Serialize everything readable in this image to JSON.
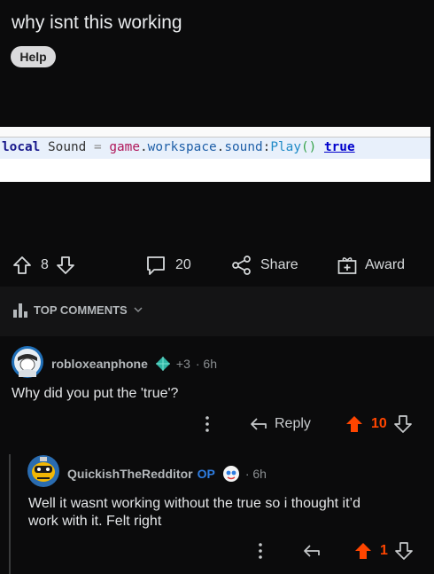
{
  "post": {
    "title": "why isnt this working",
    "flair": "Help",
    "code": {
      "kw_local": "local",
      "var": "Sound",
      "eq": "=",
      "game": "game",
      "dot1": ".",
      "workspace": "workspace",
      "dot2": ".",
      "sound": "sound",
      "colon": ":",
      "play": "Play",
      "parens": "()",
      "bool": "true"
    }
  },
  "actions": {
    "votes": "8",
    "comments": "20",
    "share": "Share",
    "award": "Award"
  },
  "comments_header": {
    "label": "TOP COMMENTS"
  },
  "comments": [
    {
      "author": "robloxeanphone",
      "award_count": "+3",
      "time": "· 6h",
      "body": "Why did you put the 'true'?",
      "reply": "Reply",
      "score": "10"
    },
    {
      "author": "QuickishTheRedditor",
      "op_tag": "OP",
      "time": "· 6h",
      "body_line1": "Well it wasnt working without the true so i thought it’d",
      "body_line2": "work with it. Felt right",
      "score": "1"
    }
  ],
  "colors": {
    "upvote": "#ff4500",
    "op": "#2e7de1",
    "background": "#0b0b0c"
  }
}
